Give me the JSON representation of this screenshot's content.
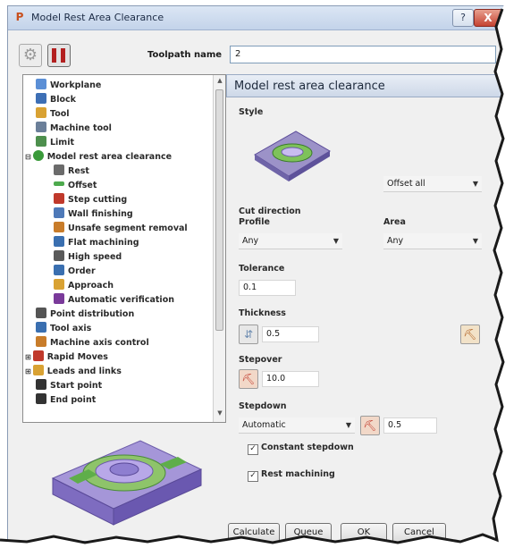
{
  "window": {
    "title": "Model Rest Area Clearance",
    "help_label": "?",
    "close_label": "X"
  },
  "toolpath": {
    "label": "Toolpath name",
    "value": "2"
  },
  "tree": {
    "items": [
      {
        "label": "Workplane",
        "icon": "workplane-icon",
        "color": "#5b8fd6"
      },
      {
        "label": "Block",
        "icon": "block-icon",
        "color": "#3d6fb5"
      },
      {
        "label": "Tool",
        "icon": "tool-icon",
        "color": "#d9a233"
      },
      {
        "label": "Machine tool",
        "icon": "machine-tool-icon",
        "color": "#6b7f99"
      },
      {
        "label": "Limit",
        "icon": "limit-icon",
        "color": "#4d8f4d"
      },
      {
        "label": "Model rest area clearance",
        "icon": "strategy-icon",
        "color": "#3a9a3a"
      },
      {
        "label": "Rest",
        "icon": "rest-icon",
        "color": "#6b6b6b"
      },
      {
        "label": "Offset",
        "icon": "offset-icon",
        "color": "#4daa4d"
      },
      {
        "label": "Step cutting",
        "icon": "step-cutting-icon",
        "color": "#c0392b"
      },
      {
        "label": "Wall finishing",
        "icon": "wall-finishing-icon",
        "color": "#4e79b8"
      },
      {
        "label": "Unsafe segment removal",
        "icon": "unsafe-segment-icon",
        "color": "#c87c2a"
      },
      {
        "label": "Flat machining",
        "icon": "flat-machining-icon",
        "color": "#3a6fb0"
      },
      {
        "label": "High speed",
        "icon": "high-speed-icon",
        "color": "#5a5a5a"
      },
      {
        "label": "Order",
        "icon": "order-icon",
        "color": "#3a6fb0"
      },
      {
        "label": "Approach",
        "icon": "approach-icon",
        "color": "#d9a233"
      },
      {
        "label": "Automatic verification",
        "icon": "verification-icon",
        "color": "#7a3a9a"
      },
      {
        "label": "Point distribution",
        "icon": "point-distribution-icon",
        "color": "#555555"
      },
      {
        "label": "Tool axis",
        "icon": "tool-axis-icon",
        "color": "#3a6fb0"
      },
      {
        "label": "Machine axis control",
        "icon": "axis-control-icon",
        "color": "#c87c2a"
      },
      {
        "label": "Rapid Moves",
        "icon": "rapid-moves-icon",
        "color": "#c0392b"
      },
      {
        "label": "Leads and links",
        "icon": "leads-links-icon",
        "color": "#d9a233"
      },
      {
        "label": "Start point",
        "icon": "start-point-icon",
        "color": "#333333"
      },
      {
        "label": "End point",
        "icon": "end-point-icon",
        "color": "#333333"
      }
    ]
  },
  "panel": {
    "header": "Model rest area clearance",
    "style_label": "Style",
    "style_value": "Offset all",
    "cut_direction_label": "Cut direction",
    "profile_label": "Profile",
    "profile_value": "Any",
    "area_label": "Area",
    "area_value": "Any",
    "tolerance_label": "Tolerance",
    "tolerance_value": "0.1",
    "thickness_label": "Thickness",
    "thickness_value": "0.5",
    "stepover_label": "Stepover",
    "stepover_value": "10.0",
    "stepdown_label": "Stepdown",
    "stepdown_mode": "Automatic",
    "stepdown_value": "0.5",
    "constant_stepdown_label": "Constant stepdown",
    "constant_stepdown_checked": true,
    "rest_machining_label": "Rest machining",
    "rest_machining_checked": true
  },
  "buttons": {
    "calculate": "Calculate",
    "queue": "Queue",
    "ok": "OK",
    "cancel": "Cancel"
  }
}
